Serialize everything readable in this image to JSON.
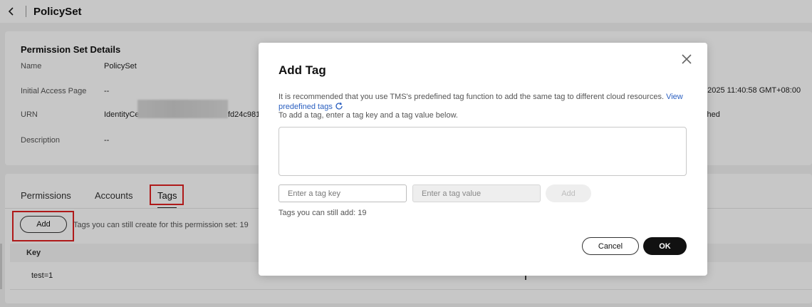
{
  "header": {
    "title": "PolicySet",
    "back_icon": "chevron-left-icon"
  },
  "details": {
    "section_title": "Permission Set Details",
    "fields": [
      {
        "label": "Name",
        "value": "PolicySet"
      },
      {
        "label": "Initial Access Page",
        "value": "--"
      },
      {
        "label": "URN",
        "value_prefix": "IdentityCe",
        "value_suffix": "fd24c981"
      },
      {
        "label": "Description",
        "value": "--"
      }
    ],
    "right_fragments": {
      "created": ", 2025 11:40:58 GMT+08:00",
      "status": "ched"
    }
  },
  "tabs": {
    "items": [
      {
        "label": "Permissions"
      },
      {
        "label": "Accounts"
      },
      {
        "label": "Tags",
        "active": true
      }
    ],
    "add_button": "Add",
    "still_create_text": "Tags you can still create for this permission set: 19",
    "table": {
      "columns": [
        "Key"
      ],
      "rows": [
        {
          "key": "test=1"
        }
      ]
    }
  },
  "modal": {
    "title": "Add Tag",
    "hint_text": "It is recommended that you use TMS's predefined tag function to add the same tag to different cloud resources.",
    "hint_link": "View predefined tags",
    "hint2": "To add a tag, enter a tag key and a tag value below.",
    "key_placeholder": "Enter a tag key",
    "value_placeholder": "Enter a tag value",
    "add_label": "Add",
    "can_add_text": "Tags you can still add: 19",
    "cancel_label": "Cancel",
    "ok_label": "OK"
  },
  "colors": {
    "highlight_box": "#e02020",
    "link": "#2a5fc0",
    "primary_button": "#111111"
  }
}
